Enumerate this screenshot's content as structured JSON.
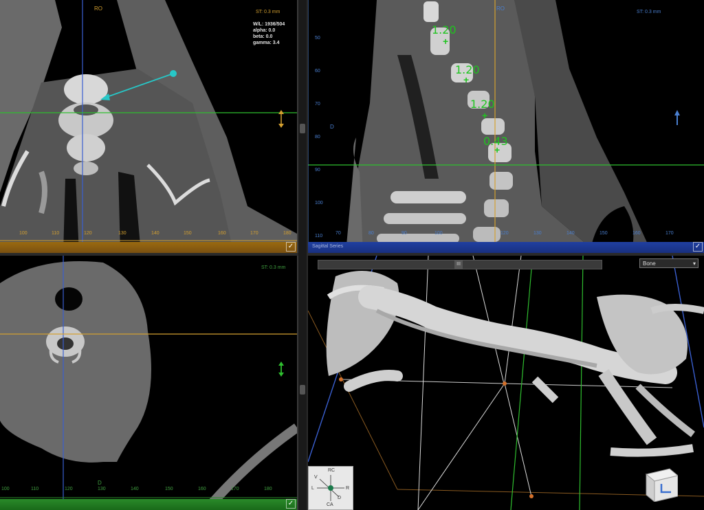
{
  "coronal": {
    "orientation_top": "RO",
    "slice_thickness": "ST: 0.3 mm",
    "info_lines": [
      "W/L: 1936/504",
      "alpha: 0.0",
      "beta: 0.0",
      "gamma: 3.4"
    ],
    "ruler_ticks": [
      "100",
      "110",
      "120",
      "130",
      "140",
      "150",
      "160",
      "170",
      "180"
    ]
  },
  "sagittal": {
    "orientation_top": "RO",
    "orientation_left": "D",
    "slice_thickness": "ST: 0.3 mm",
    "left_ticks": [
      "50",
      "60",
      "70",
      "80",
      "90",
      "100",
      "110",
      "120"
    ],
    "bottom_ticks": [
      "70",
      "80",
      "90",
      "100",
      "110",
      "120",
      "130",
      "140",
      "150",
      "160",
      "170"
    ],
    "measurements": [
      "1.20",
      "1.20",
      "1.20",
      "0.43"
    ],
    "footer_label": "Sagittal Series"
  },
  "axial": {
    "slice_thickness": "ST: 0.3 mm",
    "orientation_bottom": "D",
    "ruler_ticks": [
      "100",
      "110",
      "120",
      "130",
      "140",
      "150",
      "160",
      "170",
      "180"
    ]
  },
  "volume3d": {
    "toolbar_center": "III",
    "preset_value": "Bone",
    "compass": {
      "top": "RC",
      "left": "L",
      "right": "R",
      "bottom": "CA",
      "upper_left": "V",
      "lower_right": "D"
    }
  },
  "colors": {
    "coronal_accent": "#d4a030",
    "sagittal_accent": "#4a7fd0",
    "axial_accent": "#2a8a2a",
    "measure_green": "#1fc41f",
    "annotation_cyan": "#27c7c7"
  }
}
